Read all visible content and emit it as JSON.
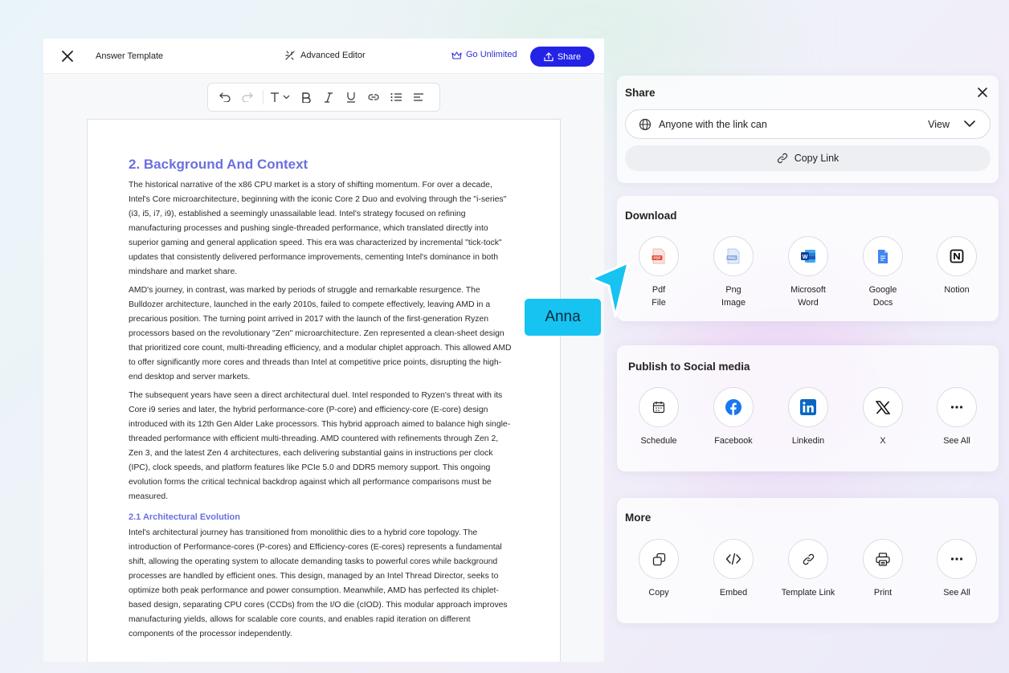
{
  "editor": {
    "doc_title": "Answer Template",
    "advanced_editor": "Advanced Editor",
    "go_unlimited": "Go Unlimited",
    "share": "Share"
  },
  "document": {
    "heading": "2. Background And Context",
    "paragraphs": [
      "The historical narrative of the x86 CPU market is a story of shifting momentum. For over a decade, Intel's Core microarchitecture, beginning with the iconic Core 2 Duo and evolving through the \"i-series\" (i3, i5, i7, i9), established a seemingly unassailable lead. Intel's strategy focused on refining manufacturing processes and pushing single-threaded performance, which translated directly into superior gaming and general application speed. This era was characterized by incremental \"tick-tock\" updates that consistently delivered performance improvements, cementing Intel's dominance in both mindshare and market share.",
      "AMD's journey, in contrast, was marked by periods of struggle and remarkable resurgence. The Bulldozer architecture, launched in the early 2010s, failed to compete effectively, leaving AMD in a precarious position. The turning point arrived in 2017 with the launch of the first-generation Ryzen processors based on the revolutionary \"Zen\" microarchitecture. Zen represented a clean-sheet design that prioritized core count, multi-threading efficiency, and a modular chiplet approach. This allowed AMD to offer significantly more cores and threads than Intel at competitive price points, disrupting the high-end desktop and server markets.",
      "The subsequent years have seen a direct architectural duel. Intel responded to Ryzen's threat with its Core i9 series and later, the hybrid performance-core (P-core) and efficiency-core (E-core) design introduced with its 12th Gen Alder Lake processors. This hybrid approach aimed to balance high single-threaded performance with efficient multi-threading. AMD countered with refinements through Zen 2, Zen 3, and the latest Zen 4 architectures, each delivering substantial gains in instructions per clock (IPC), clock speeds, and platform features like PCIe 5.0 and DDR5 memory support. This ongoing evolution forms the critical technical backdrop against which all performance comparisons must be measured."
    ],
    "subheading": "2.1 Architectural Evolution",
    "paragraph4": "Intel's architectural journey has transitioned from monolithic dies to a hybrid core topology. The introduction of Performance-cores (P-cores) and Efficiency-cores (E-cores) represents a fundamental shift, allowing the operating system to allocate demanding tasks to powerful cores while background processes are handled by efficient ones. This design, managed by an Intel Thread Director, seeks to optimize both peak performance and power consumption. Meanwhile, AMD has perfected its chiplet-based design, separating CPU cores (CCDs) from the I/O die (cIOD). This modular approach improves manufacturing yields, allows for scalable core counts, and enables rapid iteration on different components of the processor independently."
  },
  "share_panel": {
    "title": "Share",
    "access_text": "Anyone with the link can",
    "access_level": "View",
    "copy_link": "Copy Link"
  },
  "download": {
    "title": "Download",
    "items": [
      {
        "line1": "Pdf",
        "line2": "File",
        "icon": "pdf-icon"
      },
      {
        "line1": "Png",
        "line2": "Image",
        "icon": "png-icon"
      },
      {
        "line1": "Microsoft",
        "line2": "Word",
        "icon": "word-icon"
      },
      {
        "line1": "Google",
        "line2": "Docs",
        "icon": "google-docs-icon"
      },
      {
        "line1": "Notion",
        "line2": "",
        "icon": "notion-icon"
      }
    ]
  },
  "social": {
    "title": "Publish to Social media",
    "items": [
      {
        "label": "Schedule",
        "icon": "calendar-icon"
      },
      {
        "label": "Facebook",
        "icon": "facebook-icon"
      },
      {
        "label": "Linkedin",
        "icon": "linkedin-icon"
      },
      {
        "label": "X",
        "icon": "x-icon"
      },
      {
        "label": "See All",
        "icon": "more-icon"
      }
    ]
  },
  "more": {
    "title": "More",
    "items": [
      {
        "label": "Copy",
        "icon": "copy-icon"
      },
      {
        "label": "Embed",
        "icon": "code-icon"
      },
      {
        "label": "Template Link",
        "icon": "link-icon"
      },
      {
        "label": "Print",
        "icon": "printer-icon"
      },
      {
        "label": "See All",
        "icon": "more-icon"
      }
    ]
  },
  "cursor_label": "Anna",
  "colors": {
    "accent": "#2323e6",
    "heading": "#6b6fe0",
    "cursor": "#16c3f1"
  }
}
